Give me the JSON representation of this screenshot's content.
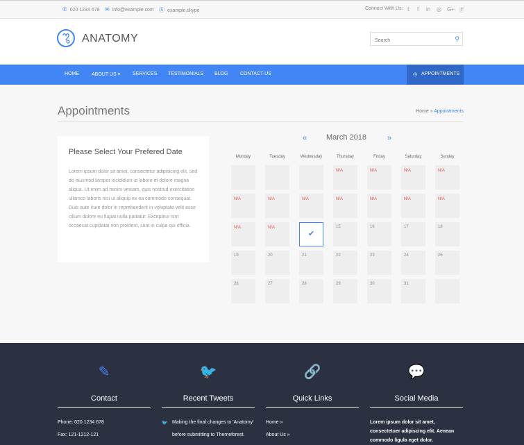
{
  "topbar": {
    "phone": "020 1234 678",
    "email": "info@example.com",
    "skype": "example.skype",
    "connect_label": "Connect With Us:",
    "social_icons": [
      "twitter-icon",
      "facebook-icon",
      "linkedin-icon",
      "instagram-icon",
      "google-plus-icon",
      "pinterest-icon"
    ]
  },
  "header": {
    "logo_text": "ANATOMY",
    "search_placeholder": "Search"
  },
  "nav": {
    "items": [
      "HOME",
      "ABOUT US",
      "SERVICES",
      "TESTIMONIALS",
      "BLOG",
      "CONTACT US"
    ],
    "about_caret": "▾",
    "appointments": "APPOINTMENTS"
  },
  "page": {
    "title": "Appointments",
    "breadcrumb_home": "Home",
    "breadcrumb_sep": "»",
    "breadcrumb_current": "Appointments"
  },
  "panel": {
    "heading": "Please Select Your Prefered Date",
    "body": "Lorem ipsum dolor sit amet, consectetur adipisicing elit, sed do eiusmod tempor incididunt ut labore et dolore magna aliqua. Ut enim ad minim veniam, quis nostrud exercitation ullamco laboris nisi ut aliquip ex ea commodo consequat. Duis aute irure dolor in reprehenderit in voluptate velit esse cillum dolore eu fugiat nulla pariatur. Excepteur sint occaecat cupidatat non proident, sunt in culpa qui officia."
  },
  "calendar": {
    "month_label": "March 2018",
    "prev": "«",
    "next": "»",
    "days": [
      "Monday",
      "Tuesday",
      "Wednesday",
      "Thursday",
      "Friday",
      "Saturday",
      "Sunday"
    ],
    "weeks": [
      [
        "",
        "",
        "",
        "N/A",
        "N/A",
        "N/A",
        "N/A"
      ],
      [
        "N/A",
        "N/A",
        "N/A",
        "N/A",
        "N/A",
        "N/A",
        "N/A"
      ],
      [
        "N/A",
        "N/A",
        "",
        "15",
        "16",
        "17",
        "18"
      ],
      [
        "19",
        "20",
        "21",
        "22",
        "23",
        "24",
        "25"
      ],
      [
        "26",
        "27",
        "28",
        "29",
        "30",
        "31",
        ""
      ]
    ],
    "selected": "✔"
  },
  "footer": {
    "columns": [
      {
        "title": "Contact",
        "icon": "pencil-icon",
        "glyph": "✎"
      },
      {
        "title": "Recent Tweets",
        "icon": "twitter-icon",
        "glyph": "🐦"
      },
      {
        "title": "Quick Links",
        "icon": "link-icon",
        "glyph": "🔗"
      },
      {
        "title": "Social Media",
        "icon": "comments-icon",
        "glyph": "💬"
      }
    ],
    "phone": "Phone: 020 1234 678",
    "fax": "Fax: 121-1212-121",
    "tweet_line1": "Making the final changes to 'Anatomy'",
    "tweet_line2": "before submitting to Themeforest.",
    "link1": "Home »",
    "link2": "About Us »",
    "social_text": "Lorem ipsum dolor sit amet, consectetuer adipiscing elit. Aenean commodo ligula eget dolor."
  },
  "colors": {
    "accent": "#4285f4",
    "footer_bg": "#2c3142",
    "na_red": "#e05a4a"
  }
}
